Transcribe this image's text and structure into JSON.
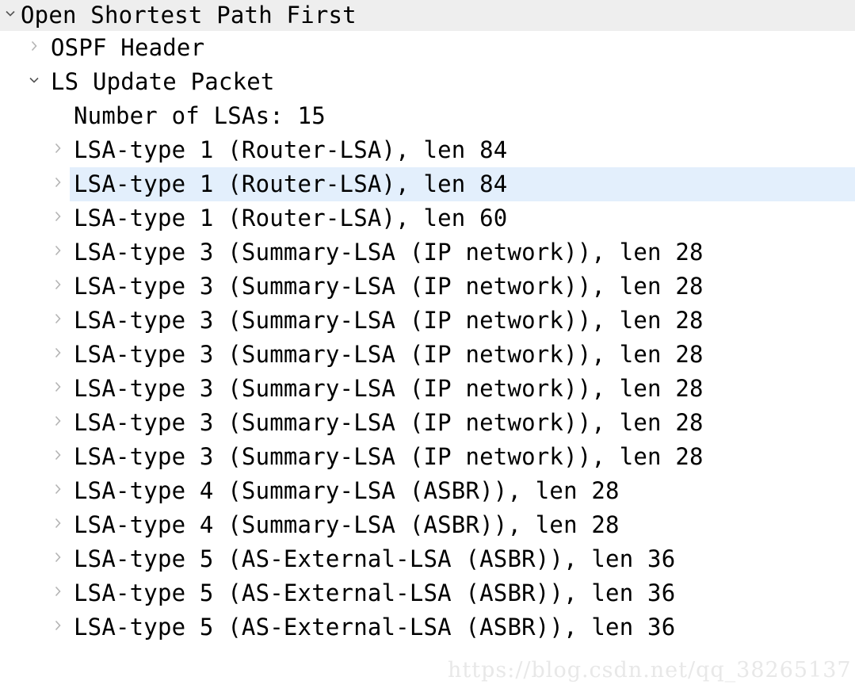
{
  "tree": {
    "rows": [
      {
        "label": "Open Shortest Path First",
        "level": 1,
        "twisty": "chevron-down-icon",
        "expanded": true,
        "highlight": "gray"
      },
      {
        "label": "OSPF Header",
        "level": 2,
        "twisty": "chevron-right-icon",
        "expanded": false,
        "highlight": "none"
      },
      {
        "label": "LS Update Packet",
        "level": 2,
        "twisty": "chevron-down-icon",
        "expanded": true,
        "highlight": "none"
      },
      {
        "label": "Number of LSAs: 15",
        "level": 3,
        "twisty": "none",
        "expanded": false,
        "highlight": "none"
      },
      {
        "label": "LSA-type 1 (Router-LSA), len 84",
        "level": 3,
        "twisty": "chevron-right-icon",
        "expanded": false,
        "highlight": "none"
      },
      {
        "label": "LSA-type 1 (Router-LSA), len 84",
        "level": 3,
        "twisty": "chevron-right-icon",
        "expanded": false,
        "highlight": "blue"
      },
      {
        "label": "LSA-type 1 (Router-LSA), len 60",
        "level": 3,
        "twisty": "chevron-right-icon",
        "expanded": false,
        "highlight": "none"
      },
      {
        "label": "LSA-type 3 (Summary-LSA (IP network)), len 28",
        "level": 3,
        "twisty": "chevron-right-icon",
        "expanded": false,
        "highlight": "none"
      },
      {
        "label": "LSA-type 3 (Summary-LSA (IP network)), len 28",
        "level": 3,
        "twisty": "chevron-right-icon",
        "expanded": false,
        "highlight": "none"
      },
      {
        "label": "LSA-type 3 (Summary-LSA (IP network)), len 28",
        "level": 3,
        "twisty": "chevron-right-icon",
        "expanded": false,
        "highlight": "none"
      },
      {
        "label": "LSA-type 3 (Summary-LSA (IP network)), len 28",
        "level": 3,
        "twisty": "chevron-right-icon",
        "expanded": false,
        "highlight": "none"
      },
      {
        "label": "LSA-type 3 (Summary-LSA (IP network)), len 28",
        "level": 3,
        "twisty": "chevron-right-icon",
        "expanded": false,
        "highlight": "none"
      },
      {
        "label": "LSA-type 3 (Summary-LSA (IP network)), len 28",
        "level": 3,
        "twisty": "chevron-right-icon",
        "expanded": false,
        "highlight": "none"
      },
      {
        "label": "LSA-type 3 (Summary-LSA (IP network)), len 28",
        "level": 3,
        "twisty": "chevron-right-icon",
        "expanded": false,
        "highlight": "none"
      },
      {
        "label": "LSA-type 4 (Summary-LSA (ASBR)), len 28",
        "level": 3,
        "twisty": "chevron-right-icon",
        "expanded": false,
        "highlight": "none"
      },
      {
        "label": "LSA-type 4 (Summary-LSA (ASBR)), len 28",
        "level": 3,
        "twisty": "chevron-right-icon",
        "expanded": false,
        "highlight": "none"
      },
      {
        "label": "LSA-type 5 (AS-External-LSA (ASBR)), len 36",
        "level": 3,
        "twisty": "chevron-right-icon",
        "expanded": false,
        "highlight": "none"
      },
      {
        "label": "LSA-type 5 (AS-External-LSA (ASBR)), len 36",
        "level": 3,
        "twisty": "chevron-right-icon",
        "expanded": false,
        "highlight": "none"
      },
      {
        "label": "LSA-type 5 (AS-External-LSA (ASBR)), len 36",
        "level": 3,
        "twisty": "chevron-right-icon",
        "expanded": false,
        "highlight": "none"
      }
    ]
  },
  "watermark": {
    "text": "https://blog.csdn.net/qq_38265137"
  },
  "colors": {
    "selected_row_bg": "#e3effc",
    "header_row_bg": "#eeeeee",
    "text": "#000000",
    "twisty_open": "#555555",
    "twisty_closed": "#b4b4b4",
    "watermark": "#e8e8e8"
  }
}
